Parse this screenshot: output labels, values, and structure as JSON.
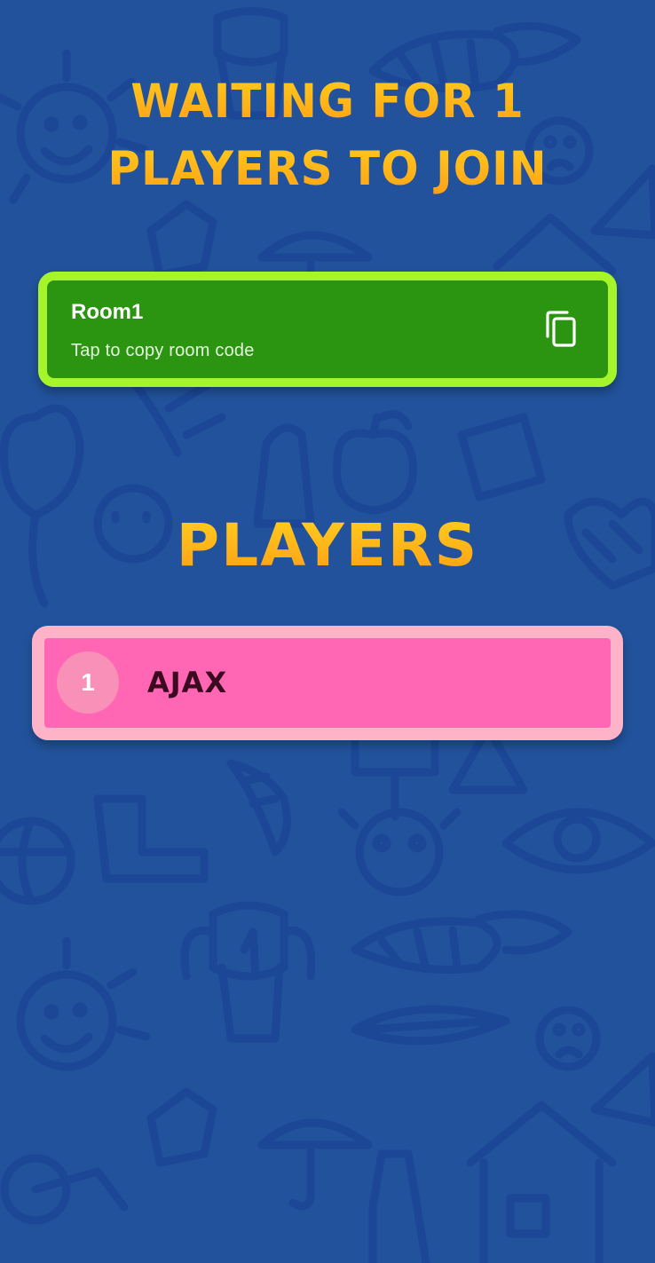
{
  "header": {
    "title_line1": "WAITING FOR 1",
    "title_line2": "PLAYERS TO JOIN"
  },
  "room": {
    "name": "Room1",
    "hint": "Tap to copy room code",
    "copy_icon": "copy-icon"
  },
  "players_section": {
    "heading": "PLAYERS",
    "items": [
      {
        "number": "1",
        "name": "AJAX"
      }
    ]
  },
  "colors": {
    "background": "#22529b",
    "doodle": "#1b4796",
    "title_gradient_top": "#ffd21f",
    "title_gradient_bottom": "#ff9a14",
    "room_card": "#2b9411",
    "room_border": "#a6f52a",
    "player_card": "#ff66b3",
    "player_border": "#ffb3c8",
    "player_badge": "#f890b8",
    "player_name": "#3a0a1f"
  }
}
